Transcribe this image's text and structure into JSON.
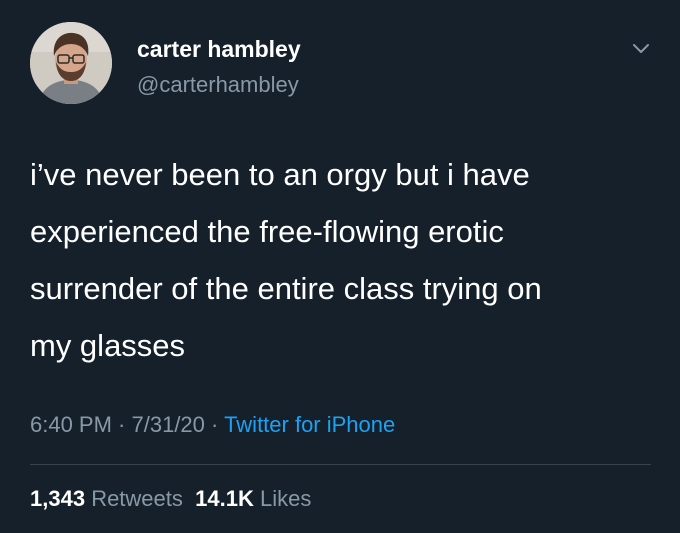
{
  "author": {
    "display_name": "carter hambley",
    "handle": "@carterhambley",
    "avatar_icon": "profile-photo"
  },
  "tweet": {
    "text": "i’ve never been to an orgy but i have\nexperienced the free-flowing erotic\nsurrender of the entire class trying on\nmy glasses"
  },
  "meta": {
    "time": "6:40 PM",
    "sep1": " · ",
    "date": "7/31/20",
    "sep2": " · ",
    "source": "Twitter for iPhone"
  },
  "stats": {
    "retweets_count": "1,343",
    "retweets_label": "Retweets",
    "likes_count": "14.1K",
    "likes_label": "Likes"
  },
  "menu": {
    "icon": "chevron-down-icon"
  },
  "colors": {
    "background": "#15202b",
    "secondary_text": "#8899a6",
    "link": "#1da1f2",
    "divider": "#38444d"
  }
}
